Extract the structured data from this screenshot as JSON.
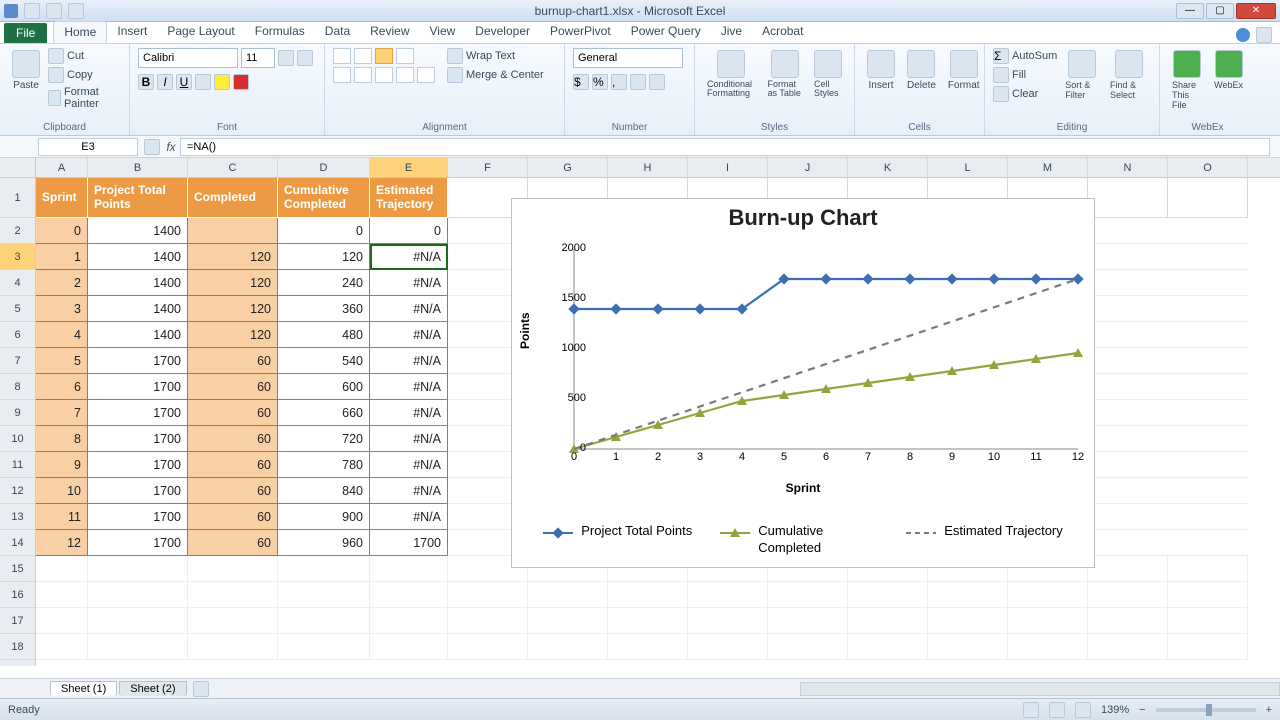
{
  "titlebar": {
    "title": "burnup-chart1.xlsx - Microsoft Excel"
  },
  "tabs": {
    "file": "File",
    "items": [
      "Home",
      "Insert",
      "Page Layout",
      "Formulas",
      "Data",
      "Review",
      "View",
      "Developer",
      "PowerPivot",
      "Power Query",
      "Jive",
      "Acrobat"
    ],
    "active": "Home"
  },
  "ribbon": {
    "clipboard": {
      "label": "Clipboard",
      "paste": "Paste",
      "cut": "Cut",
      "copy": "Copy",
      "fmtpainter": "Format Painter"
    },
    "font": {
      "label": "Font",
      "name": "Calibri",
      "size": "11"
    },
    "alignment": {
      "label": "Alignment",
      "wrap": "Wrap Text",
      "merge": "Merge & Center"
    },
    "number": {
      "label": "Number",
      "format": "General"
    },
    "styles": {
      "label": "Styles",
      "cond": "Conditional Formatting",
      "table": "Format as Table",
      "cell": "Cell Styles"
    },
    "cells": {
      "label": "Cells",
      "insert": "Insert",
      "delete": "Delete",
      "format": "Format"
    },
    "editing": {
      "label": "Editing",
      "autosum": "AutoSum",
      "fill": "Fill",
      "clear": "Clear",
      "sort": "Sort & Filter",
      "find": "Find & Select"
    },
    "webex": {
      "label": "WebEx",
      "share": "Share This File",
      "webex": "WebEx"
    }
  },
  "formulabar": {
    "namebox": "E3",
    "formula": "=NA()"
  },
  "columns": [
    "A",
    "B",
    "C",
    "D",
    "E",
    "F",
    "G",
    "H",
    "I",
    "J",
    "K",
    "L",
    "M",
    "N",
    "O"
  ],
  "headers": {
    "A": "Sprint",
    "B": "Project Total Points",
    "C": "Completed",
    "D": "Cumulative Completed",
    "E": "Estimated Trajectory"
  },
  "table": [
    {
      "sprint": 0,
      "total": 1400,
      "completed": "",
      "cum": 0,
      "est": "0"
    },
    {
      "sprint": 1,
      "total": 1400,
      "completed": 120,
      "cum": 120,
      "est": "#N/A"
    },
    {
      "sprint": 2,
      "total": 1400,
      "completed": 120,
      "cum": 240,
      "est": "#N/A"
    },
    {
      "sprint": 3,
      "total": 1400,
      "completed": 120,
      "cum": 360,
      "est": "#N/A"
    },
    {
      "sprint": 4,
      "total": 1400,
      "completed": 120,
      "cum": 480,
      "est": "#N/A"
    },
    {
      "sprint": 5,
      "total": 1700,
      "completed": 60,
      "cum": 540,
      "est": "#N/A"
    },
    {
      "sprint": 6,
      "total": 1700,
      "completed": 60,
      "cum": 600,
      "est": "#N/A"
    },
    {
      "sprint": 7,
      "total": 1700,
      "completed": 60,
      "cum": 660,
      "est": "#N/A"
    },
    {
      "sprint": 8,
      "total": 1700,
      "completed": 60,
      "cum": 720,
      "est": "#N/A"
    },
    {
      "sprint": 9,
      "total": 1700,
      "completed": 60,
      "cum": 780,
      "est": "#N/A"
    },
    {
      "sprint": 10,
      "total": 1700,
      "completed": 60,
      "cum": 840,
      "est": "#N/A"
    },
    {
      "sprint": 11,
      "total": 1700,
      "completed": 60,
      "cum": 900,
      "est": "#N/A"
    },
    {
      "sprint": 12,
      "total": 1700,
      "completed": 60,
      "cum": 960,
      "est": "1700"
    }
  ],
  "selected_cell": "E3",
  "sheets": {
    "tabs": [
      "Sheet (1)",
      "Sheet (2)"
    ],
    "active": 0
  },
  "statusbar": {
    "state": "Ready",
    "zoom": "139%"
  },
  "chart_data": {
    "type": "line",
    "title": "Burn-up Chart",
    "xlabel": "Sprint",
    "ylabel": "Points",
    "x": [
      0,
      1,
      2,
      3,
      4,
      5,
      6,
      7,
      8,
      9,
      10,
      11,
      12
    ],
    "ylim": [
      0,
      2000
    ],
    "yticks": [
      0,
      500,
      1000,
      1500,
      2000
    ],
    "series": [
      {
        "name": "Project Total Points",
        "color": "#3d6fb5",
        "marker": "diamond",
        "values": [
          1400,
          1400,
          1400,
          1400,
          1400,
          1700,
          1700,
          1700,
          1700,
          1700,
          1700,
          1700,
          1700
        ]
      },
      {
        "name": "Cumulative Completed",
        "color": "#8fa63e",
        "marker": "triangle",
        "values": [
          0,
          120,
          240,
          360,
          480,
          540,
          600,
          660,
          720,
          780,
          840,
          900,
          960
        ]
      },
      {
        "name": "Estimated Trajectory",
        "color": "#7a7a7a",
        "style": "dashed",
        "marker": "none",
        "values": [
          0,
          141.67,
          283.33,
          425,
          566.67,
          708.33,
          850,
          991.67,
          1133.33,
          1275,
          1416.67,
          1558.33,
          1700
        ]
      }
    ],
    "legend": [
      "Project Total Points",
      "Cumulative Completed",
      "Estimated Trajectory"
    ]
  }
}
